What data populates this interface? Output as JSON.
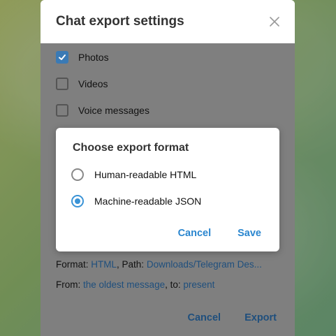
{
  "window": {
    "title": "Chat export settings"
  },
  "media_options": [
    {
      "label": "Photos",
      "checked": true
    },
    {
      "label": "Videos",
      "checked": false
    },
    {
      "label": "Voice messages",
      "checked": false
    }
  ],
  "format_line": {
    "format_prefix": "Format:",
    "format_value": "HTML",
    "path_prefix": ", Path:",
    "path_value": "Downloads/Telegram Des..."
  },
  "range_line": {
    "from_prefix": "From:",
    "from_value": "the oldest message",
    "to_prefix": ", to:",
    "to_value": "present"
  },
  "panel_actions": {
    "cancel": "Cancel",
    "export": "Export"
  },
  "format_dialog": {
    "title": "Choose export format",
    "options": [
      {
        "label": "Human-readable HTML",
        "selected": false
      },
      {
        "label": "Machine-readable JSON",
        "selected": true
      }
    ],
    "cancel": "Cancel",
    "save": "Save"
  },
  "colors": {
    "accent": "#2a86cf",
    "link": "#1f4f7d",
    "checkbox_checked": "#3a7ab5"
  },
  "icons": {
    "close": "close-icon",
    "check": "checkmark-icon"
  }
}
